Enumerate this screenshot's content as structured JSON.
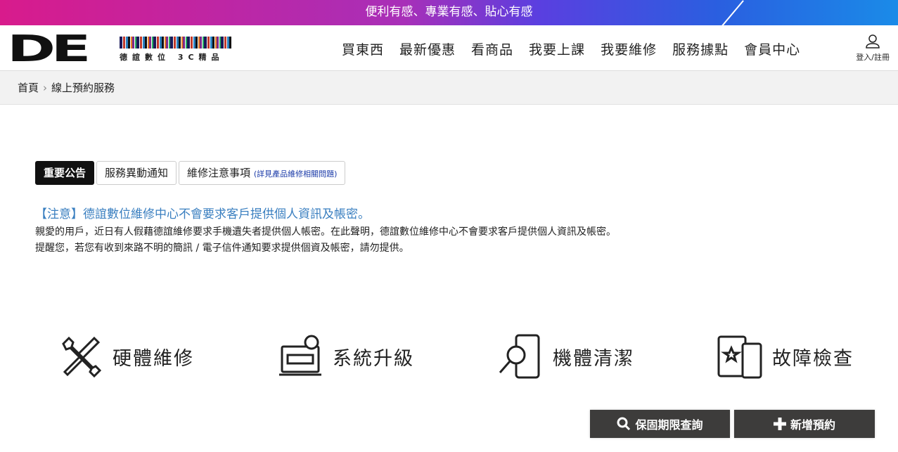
{
  "topbar": {
    "slogan": "便利有感、專業有感、貼心有感"
  },
  "logo": {
    "mark": "DE",
    "subtitle": "德誼數位 3C精品"
  },
  "nav": [
    "買東西",
    "最新優惠",
    "看商品",
    "我要上課",
    "我要維修",
    "服務據點",
    "會員中心"
  ],
  "login": "登入/註冊",
  "breadcrumb": {
    "home": "首頁",
    "current": "線上預約服務"
  },
  "tabs": [
    {
      "label": "重要公告"
    },
    {
      "label": "服務異動通知"
    },
    {
      "label": "維修注意事項",
      "note": "(詳見產品維修相關問題)"
    }
  ],
  "notice": {
    "title": "【注意】德誼數位維修中心不會要求客戶提供個人資訊及帳密。",
    "line1": "親愛的用戶，近日有人假藉德誼維修要求手機遺失者提供個人帳密。在此聲明，德誼數位維修中心不會要求客戶提供個人資訊及帳密。",
    "line2": "提醒您，若您有收到來路不明的簡訊 / 電子信件通知要求提供個資及帳密，請勿提供。"
  },
  "services": [
    "硬體維修",
    "系統升級",
    "機體清潔",
    "故障檢查"
  ],
  "buttons": {
    "warranty": "保固期限查詢",
    "new": "新增預約"
  }
}
